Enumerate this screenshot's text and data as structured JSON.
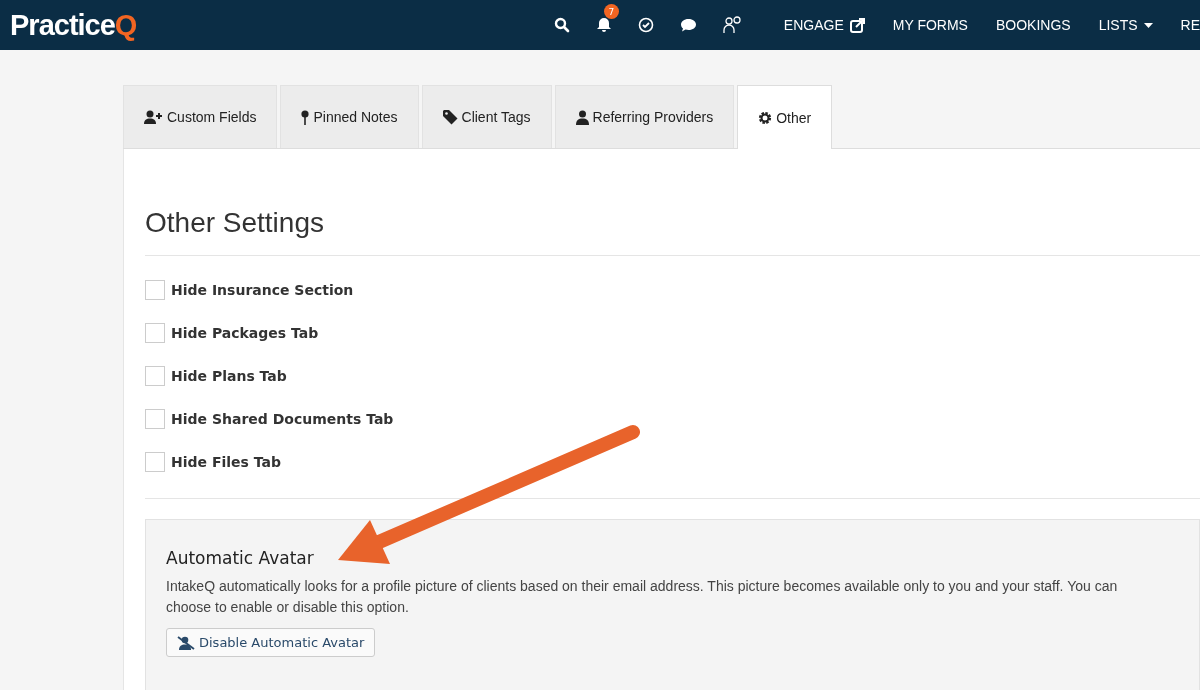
{
  "brand": {
    "text": "Practice",
    "accent": "Q"
  },
  "nav_icons": [
    {
      "kind": "search"
    },
    {
      "kind": "bell",
      "badge": "7"
    },
    {
      "kind": "check"
    },
    {
      "kind": "chat"
    },
    {
      "kind": "people"
    }
  ],
  "nav_items": [
    {
      "label": "ENGAGE",
      "kind": "external"
    },
    {
      "label": "MY FORMS",
      "kind": "plain"
    },
    {
      "label": "BOOKINGS",
      "kind": "plain"
    },
    {
      "label": "LISTS",
      "kind": "dropdown"
    },
    {
      "label": "RE",
      "kind": "plain"
    }
  ],
  "tabs": [
    {
      "label": "Custom Fields",
      "selected": false
    },
    {
      "label": "Pinned Notes",
      "selected": false
    },
    {
      "label": "Client Tags",
      "selected": false
    },
    {
      "label": "Referring Providers",
      "selected": false
    },
    {
      "label": "Other",
      "selected": true
    }
  ],
  "heading": "Other Settings",
  "options": [
    {
      "label": "Hide Insurance Section",
      "checked": false
    },
    {
      "label": "Hide Packages Tab",
      "checked": false
    },
    {
      "label": "Hide Plans Tab",
      "checked": false
    },
    {
      "label": "Hide Shared Documents Tab",
      "checked": false
    },
    {
      "label": "Hide Files Tab",
      "checked": false
    }
  ],
  "avatar": {
    "title": "Automatic Avatar",
    "text": "IntakeQ automatically looks for a profile picture of clients based on their email address. This picture becomes available only to you and your staff. You can choose to enable or disable this option.",
    "button": "Disable Automatic Avatar"
  }
}
